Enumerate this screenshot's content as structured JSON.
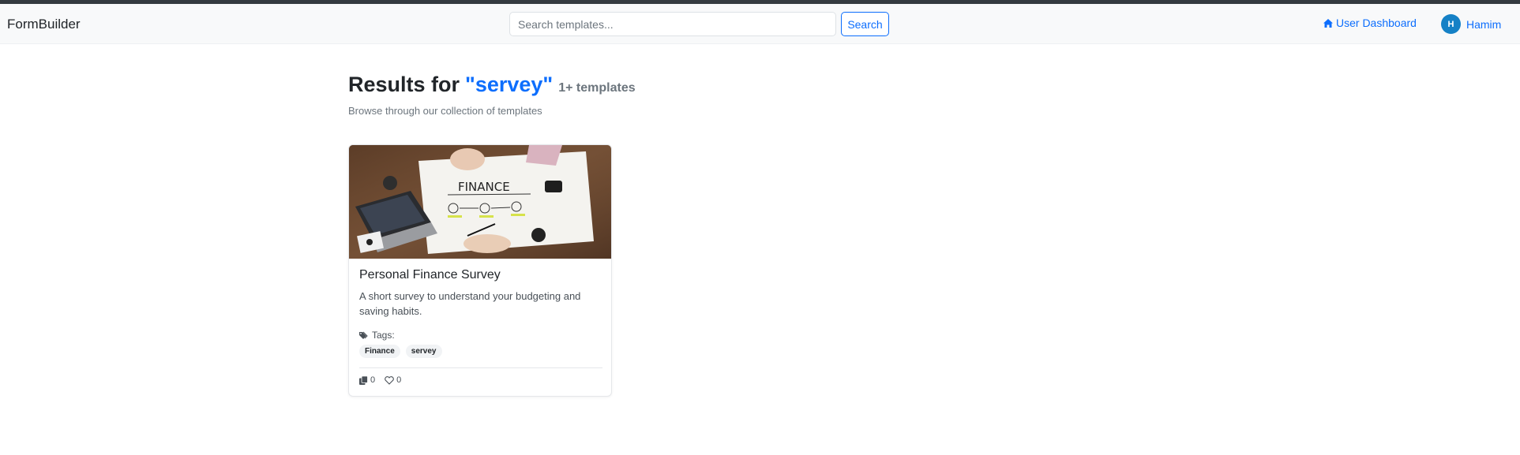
{
  "navbar": {
    "brand": "FormBuilder",
    "search": {
      "placeholder": "Search templates...",
      "value": ""
    },
    "search_button": "Search",
    "dashboard_link": {
      "label": "User Dashboard",
      "icon": "home-icon"
    },
    "user": {
      "initial": "H",
      "name": "Hamim",
      "avatar_color": "#1581c6"
    }
  },
  "results": {
    "title_prefix": "Results for",
    "query": "\"servey\"",
    "count": "1+ templates",
    "subtitle": "Browse through our collection of templates"
  },
  "templates": [
    {
      "image_alt": "finance planning photo",
      "title": "Personal Finance Survey",
      "description": "A short survey to understand your budgeting and saving habits.",
      "tags_label": "Tags:",
      "tags": [
        "Finance",
        "servey"
      ],
      "copies": "0",
      "likes": "0"
    }
  ],
  "colors": {
    "accent": "#0d6efd",
    "navbar_bg": "#f8f9fa",
    "muted": "#6c757d"
  }
}
